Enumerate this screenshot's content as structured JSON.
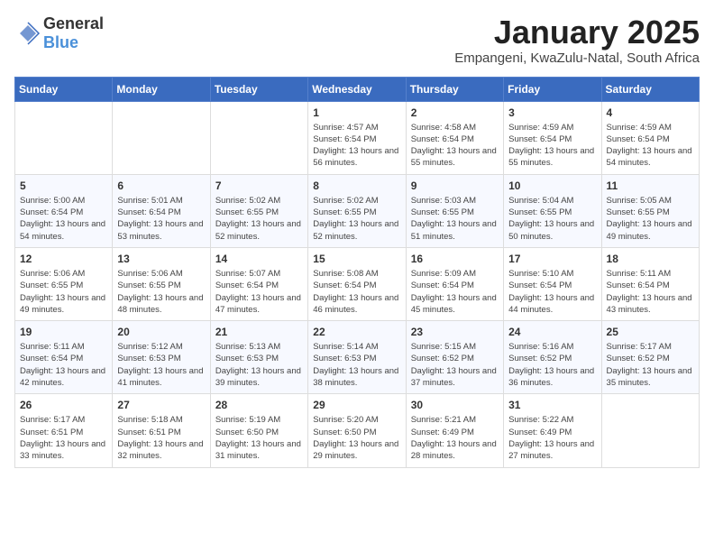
{
  "header": {
    "logo": {
      "general": "General",
      "blue": "Blue"
    },
    "title": "January 2025",
    "location": "Empangeni, KwaZulu-Natal, South Africa"
  },
  "weekdays": [
    "Sunday",
    "Monday",
    "Tuesday",
    "Wednesday",
    "Thursday",
    "Friday",
    "Saturday"
  ],
  "weeks": [
    [
      {
        "day": "",
        "info": ""
      },
      {
        "day": "",
        "info": ""
      },
      {
        "day": "",
        "info": ""
      },
      {
        "day": "1",
        "info": "Sunrise: 4:57 AM\nSunset: 6:54 PM\nDaylight: 13 hours\nand 56 minutes."
      },
      {
        "day": "2",
        "info": "Sunrise: 4:58 AM\nSunset: 6:54 PM\nDaylight: 13 hours\nand 55 minutes."
      },
      {
        "day": "3",
        "info": "Sunrise: 4:59 AM\nSunset: 6:54 PM\nDaylight: 13 hours\nand 55 minutes."
      },
      {
        "day": "4",
        "info": "Sunrise: 4:59 AM\nSunset: 6:54 PM\nDaylight: 13 hours\nand 54 minutes."
      }
    ],
    [
      {
        "day": "5",
        "info": "Sunrise: 5:00 AM\nSunset: 6:54 PM\nDaylight: 13 hours\nand 54 minutes."
      },
      {
        "day": "6",
        "info": "Sunrise: 5:01 AM\nSunset: 6:54 PM\nDaylight: 13 hours\nand 53 minutes."
      },
      {
        "day": "7",
        "info": "Sunrise: 5:02 AM\nSunset: 6:55 PM\nDaylight: 13 hours\nand 52 minutes."
      },
      {
        "day": "8",
        "info": "Sunrise: 5:02 AM\nSunset: 6:55 PM\nDaylight: 13 hours\nand 52 minutes."
      },
      {
        "day": "9",
        "info": "Sunrise: 5:03 AM\nSunset: 6:55 PM\nDaylight: 13 hours\nand 51 minutes."
      },
      {
        "day": "10",
        "info": "Sunrise: 5:04 AM\nSunset: 6:55 PM\nDaylight: 13 hours\nand 50 minutes."
      },
      {
        "day": "11",
        "info": "Sunrise: 5:05 AM\nSunset: 6:55 PM\nDaylight: 13 hours\nand 49 minutes."
      }
    ],
    [
      {
        "day": "12",
        "info": "Sunrise: 5:06 AM\nSunset: 6:55 PM\nDaylight: 13 hours\nand 49 minutes."
      },
      {
        "day": "13",
        "info": "Sunrise: 5:06 AM\nSunset: 6:55 PM\nDaylight: 13 hours\nand 48 minutes."
      },
      {
        "day": "14",
        "info": "Sunrise: 5:07 AM\nSunset: 6:54 PM\nDaylight: 13 hours\nand 47 minutes."
      },
      {
        "day": "15",
        "info": "Sunrise: 5:08 AM\nSunset: 6:54 PM\nDaylight: 13 hours\nand 46 minutes."
      },
      {
        "day": "16",
        "info": "Sunrise: 5:09 AM\nSunset: 6:54 PM\nDaylight: 13 hours\nand 45 minutes."
      },
      {
        "day": "17",
        "info": "Sunrise: 5:10 AM\nSunset: 6:54 PM\nDaylight: 13 hours\nand 44 minutes."
      },
      {
        "day": "18",
        "info": "Sunrise: 5:11 AM\nSunset: 6:54 PM\nDaylight: 13 hours\nand 43 minutes."
      }
    ],
    [
      {
        "day": "19",
        "info": "Sunrise: 5:11 AM\nSunset: 6:54 PM\nDaylight: 13 hours\nand 42 minutes."
      },
      {
        "day": "20",
        "info": "Sunrise: 5:12 AM\nSunset: 6:53 PM\nDaylight: 13 hours\nand 41 minutes."
      },
      {
        "day": "21",
        "info": "Sunrise: 5:13 AM\nSunset: 6:53 PM\nDaylight: 13 hours\nand 39 minutes."
      },
      {
        "day": "22",
        "info": "Sunrise: 5:14 AM\nSunset: 6:53 PM\nDaylight: 13 hours\nand 38 minutes."
      },
      {
        "day": "23",
        "info": "Sunrise: 5:15 AM\nSunset: 6:52 PM\nDaylight: 13 hours\nand 37 minutes."
      },
      {
        "day": "24",
        "info": "Sunrise: 5:16 AM\nSunset: 6:52 PM\nDaylight: 13 hours\nand 36 minutes."
      },
      {
        "day": "25",
        "info": "Sunrise: 5:17 AM\nSunset: 6:52 PM\nDaylight: 13 hours\nand 35 minutes."
      }
    ],
    [
      {
        "day": "26",
        "info": "Sunrise: 5:17 AM\nSunset: 6:51 PM\nDaylight: 13 hours\nand 33 minutes."
      },
      {
        "day": "27",
        "info": "Sunrise: 5:18 AM\nSunset: 6:51 PM\nDaylight: 13 hours\nand 32 minutes."
      },
      {
        "day": "28",
        "info": "Sunrise: 5:19 AM\nSunset: 6:50 PM\nDaylight: 13 hours\nand 31 minutes."
      },
      {
        "day": "29",
        "info": "Sunrise: 5:20 AM\nSunset: 6:50 PM\nDaylight: 13 hours\nand 29 minutes."
      },
      {
        "day": "30",
        "info": "Sunrise: 5:21 AM\nSunset: 6:49 PM\nDaylight: 13 hours\nand 28 minutes."
      },
      {
        "day": "31",
        "info": "Sunrise: 5:22 AM\nSunset: 6:49 PM\nDaylight: 13 hours\nand 27 minutes."
      },
      {
        "day": "",
        "info": ""
      }
    ]
  ]
}
